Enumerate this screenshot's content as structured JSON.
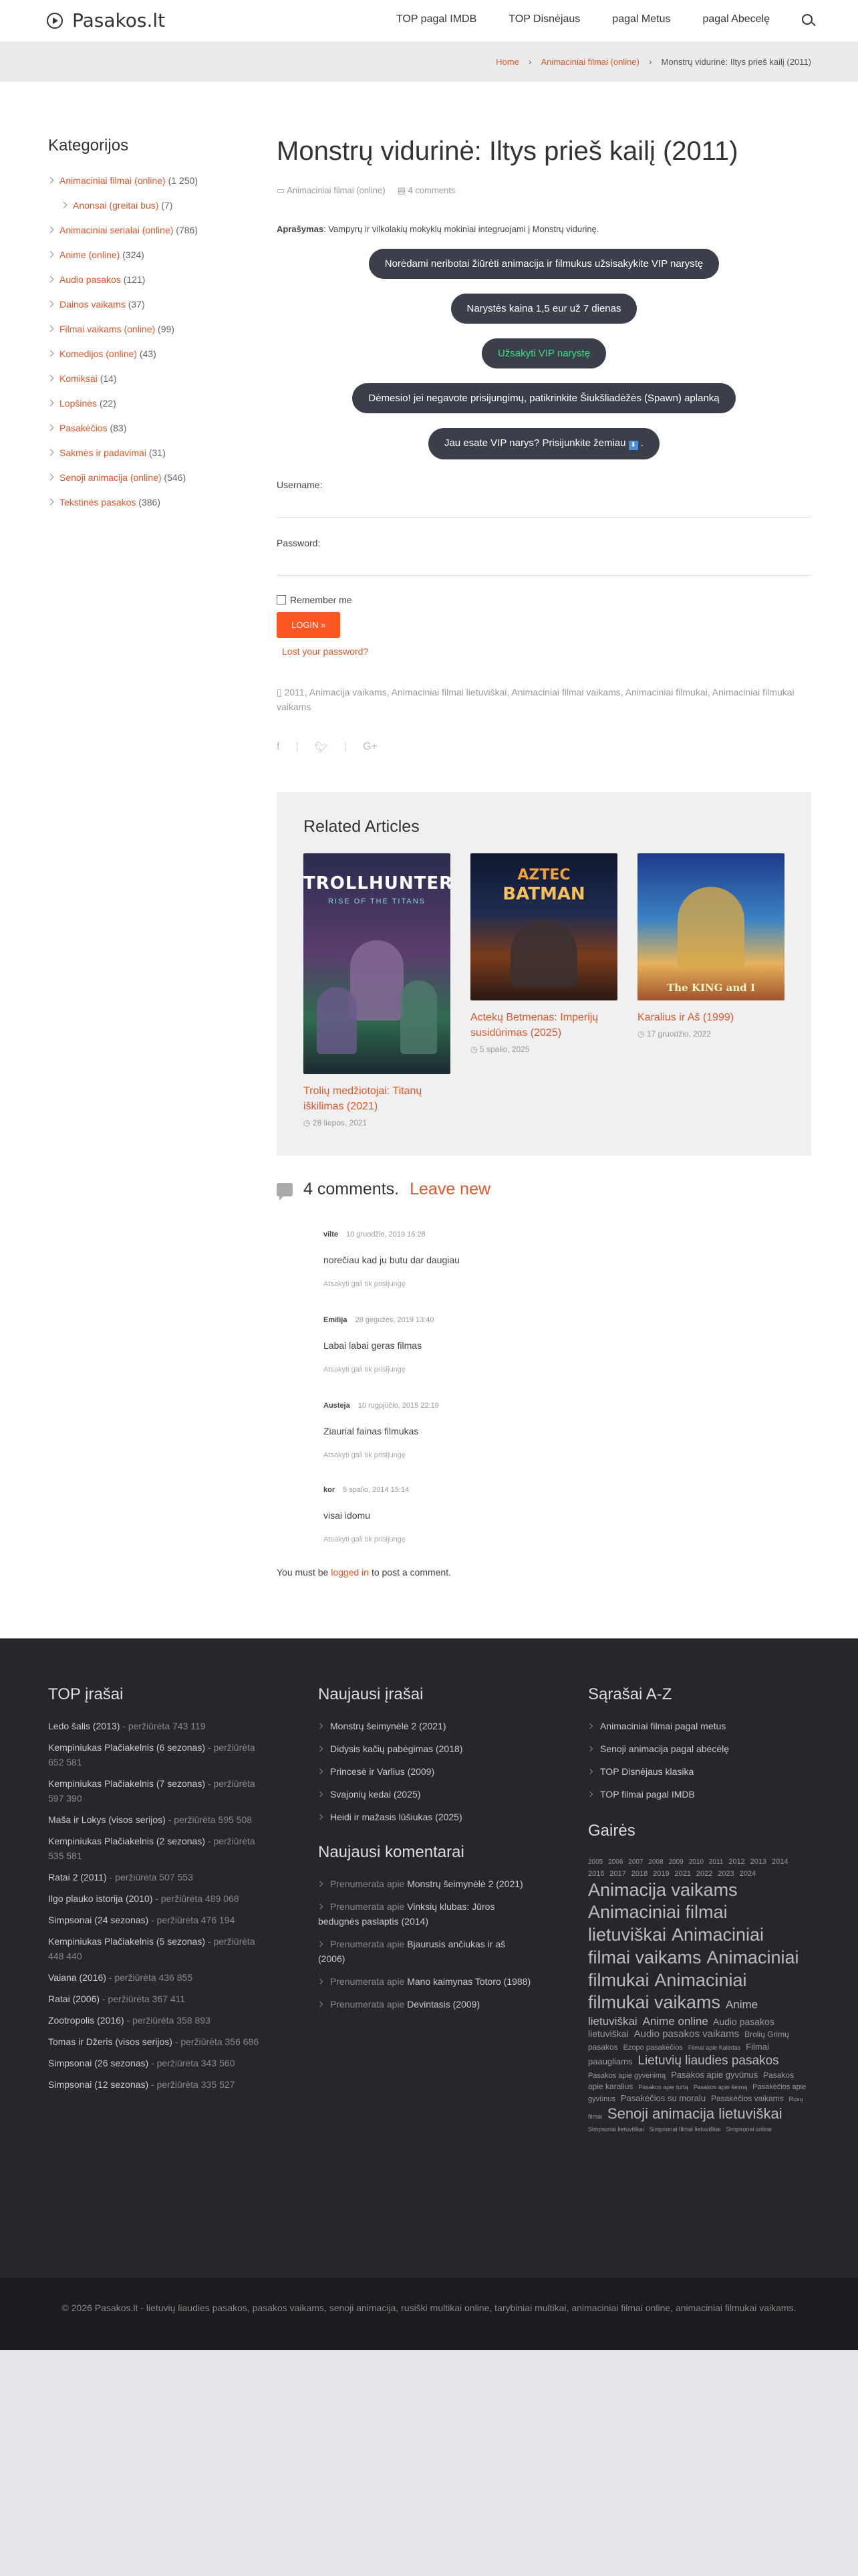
{
  "header": {
    "logo_text": "Pasakos.lt",
    "nav": [
      "TOP pagal IMDB",
      "TOP Disnėjaus",
      "pagal Metus",
      "pagal Abecelę"
    ]
  },
  "breadcrumb": {
    "home": "Home",
    "category": "Animaciniai filmai (online)",
    "current": "Monstrų vidurinė: Iltys prieš kailį (2011)"
  },
  "sidebar": {
    "title": "Kategorijos",
    "items": [
      {
        "label": "Animaciniai filmai (online)",
        "count": "(1 250)",
        "sub": false
      },
      {
        "label": "Anonsai (greitai bus)",
        "count": "(7)",
        "sub": true
      },
      {
        "label": "Animaciniai serialai (online)",
        "count": "(786)",
        "sub": false
      },
      {
        "label": "Anime (online)",
        "count": "(324)",
        "sub": false
      },
      {
        "label": "Audio pasakos",
        "count": "(121)",
        "sub": false
      },
      {
        "label": "Dainos vaikams",
        "count": "(37)",
        "sub": false
      },
      {
        "label": "Filmai vaikams (online)",
        "count": "(99)",
        "sub": false
      },
      {
        "label": "Komedijos (online)",
        "count": "(43)",
        "sub": false
      },
      {
        "label": "Komiksai",
        "count": "(14)",
        "sub": false
      },
      {
        "label": "Lopšinės",
        "count": "(22)",
        "sub": false
      },
      {
        "label": "Pasakėčios",
        "count": "(83)",
        "sub": false
      },
      {
        "label": "Sakmės ir padavimai",
        "count": "(31)",
        "sub": false
      },
      {
        "label": "Senoji animacija (online)",
        "count": "(546)",
        "sub": false
      },
      {
        "label": "Tekstinės pasakos",
        "count": "(386)",
        "sub": false
      }
    ]
  },
  "article": {
    "title": "Monstrų vidurinė: Iltys prieš kailį (2011)",
    "category": "Animaciniai filmai (online)",
    "comments_count": "4 comments",
    "desc_label": "Aprašymas",
    "desc_text": ": Vampyrų ir vilkolakių mokyklų mokiniai integruojami į Monstrų vidurinę.",
    "pills": [
      "Norėdami neribotai žiūrėti animacija ir filmukus užsisakykite VIP narystę",
      "Narystės kaina 1,5 eur už 7 dienas",
      "Užsakyti VIP narystę",
      "Dėmesio! jei negavote prisijungimų, patikrinkite Šiukšliadėžės (Spawn) aplanką",
      "Jau esate VIP narys? Prisijunkite žemiau"
    ],
    "username_label": "Username:",
    "password_label": "Password:",
    "remember_label": "Remember me",
    "login_button": "LOGIN »",
    "lost_password": "Lost your password?",
    "tags": "2011, Animacija vaikams, Animaciniai filmai lietuviškai, Animaciniai filmai vaikams, Animaciniai filmukai, Animaciniai filmukai vaikams",
    "share_icons": [
      "facebook-icon",
      "twitter-icon",
      "google-plus-icon"
    ]
  },
  "related": {
    "title": "Related Articles",
    "items": [
      {
        "title": "Trolių medžiotojai: Titanų iškilimas (2021)",
        "date": "28 liepos, 2021",
        "poster_line1": "TROLLHUNTERS",
        "poster_line2": "RISE OF THE TITANS"
      },
      {
        "title": "Actekų Betmenas: Imperijų susidūrimas (2025)",
        "date": "5 spalio, 2025",
        "poster_line1": "AZTEC",
        "poster_line2": "BATMAN"
      },
      {
        "title": "Karalius ir Aš (1999)",
        "date": "17 gruodžio, 2022",
        "poster_line1": "The KING and I",
        "poster_line2": ""
      }
    ]
  },
  "comments": {
    "heading": "4 comments.",
    "leave_new": "Leave new",
    "reply_note": "Atsakyti gali tik prisijungę",
    "list": [
      {
        "author": "vilte",
        "date": "10 gruodžio, 2019 16:28",
        "text": "norečiau kad ju butu dar daugiau"
      },
      {
        "author": "Emilija",
        "date": "28 gegužės, 2019 13:40",
        "text": "Labai labai geras filmas"
      },
      {
        "author": "Austeja",
        "date": "10 rugpjūčio, 2015 22:19",
        "text": "Ziaurial fainas filmukas"
      },
      {
        "author": "kor",
        "date": "5 spalio, 2014 15:14",
        "text": "visai idomu"
      }
    ],
    "must_before": "You must be",
    "must_link": "logged in",
    "must_after": "to post a comment."
  },
  "footer": {
    "top_title": "TOP įrašai",
    "top_items": [
      {
        "title": "Ledo šalis (2013)",
        "views": "- peržiūrėta 743 119"
      },
      {
        "title": "Kempiniukas Plačiakelnis (6 sezonas)",
        "views": "- peržiūrėta 652 581"
      },
      {
        "title": "Kempiniukas Plačiakelnis (7 sezonas)",
        "views": "- peržiūrėta 597 390"
      },
      {
        "title": "Maša ir Lokys (visos serijos)",
        "views": "- peržiūrėta 595 508"
      },
      {
        "title": "Kempiniukas Plačiakelnis (2 sezonas)",
        "views": "- peržiūrėta 535 581"
      },
      {
        "title": "Ratai 2 (2011)",
        "views": "- peržiūrėta 507 553"
      },
      {
        "title": "Ilgo plauko istorija (2010)",
        "views": "- peržiūrėta 489 068"
      },
      {
        "title": "Simpsonai (24 sezonas)",
        "views": "- peržiūrėta 476 194"
      },
      {
        "title": "Kempiniukas Plačiakelnis (5 sezonas)",
        "views": "- peržiūrėta 448 440"
      },
      {
        "title": "Vaiana (2016)",
        "views": "- peržiūrėta 436 855"
      },
      {
        "title": "Ratai (2006)",
        "views": "- peržiūrėta 367 411"
      },
      {
        "title": "Zootropolis (2016)",
        "views": "- peržiūrėta 358 893"
      },
      {
        "title": "Tomas ir Džeris (visos serijos)",
        "views": "- peržiūrėta 356 686"
      },
      {
        "title": "Simpsonai (26 sezonas)",
        "views": "- peržiūrėta 343 560"
      },
      {
        "title": "Simpsonai (12 sezonas)",
        "views": "- peržiūrėta 335 527"
      }
    ],
    "new_title": "Naujausi įrašai",
    "new_items": [
      "Monstrų šeimynėlė 2 (2021)",
      "Didysis kačių pabėgimas (2018)",
      "Princesė ir Varlius (2009)",
      "Svajonių kedai (2025)",
      "Heidi ir mažasis lūšiukas (2025)"
    ],
    "comments_title": "Naujausi komentarai",
    "comment_items": [
      {
        "who": "Prenumerata",
        "apie": "apie",
        "post": "Monstrų šeimynėlė 2 (2021)"
      },
      {
        "who": "Prenumerata",
        "apie": "apie",
        "post": "Vinksių klubas: Jūros bedugnės paslaptis (2014)"
      },
      {
        "who": "Prenumerata",
        "apie": "apie",
        "post": "Bjaurusis ančiukas ir aš (2006)"
      },
      {
        "who": "Prenumerata",
        "apie": "apie",
        "post": "Mano kaimynas Totoro (1988)"
      },
      {
        "who": "Prenumerata",
        "apie": "apie",
        "post": "Devintasis (2009)"
      }
    ],
    "az_title": "Sąrašai A-Z",
    "az_items": [
      "Animaciniai filmai pagal metus",
      "Senoji animacija pagal abėcėlę",
      "TOP Disnėjaus klasika",
      "TOP filmai pagal IMDB"
    ],
    "genres_title": "Gairės",
    "genre_tags": [
      {
        "t": "2005",
        "s": 10
      },
      {
        "t": "2006",
        "s": 10
      },
      {
        "t": "2007",
        "s": 10
      },
      {
        "t": "2008",
        "s": 10
      },
      {
        "t": "2009",
        "s": 10
      },
      {
        "t": "2010",
        "s": 10
      },
      {
        "t": "2011",
        "s": 10
      },
      {
        "t": "2012",
        "s": 11
      },
      {
        "t": "2013",
        "s": 11
      },
      {
        "t": "2014",
        "s": 11
      },
      {
        "t": "2016",
        "s": 11
      },
      {
        "t": "2017",
        "s": 11
      },
      {
        "t": "2018",
        "s": 11
      },
      {
        "t": "2019",
        "s": 11
      },
      {
        "t": "2021",
        "s": 11
      },
      {
        "t": "2022",
        "s": 11
      },
      {
        "t": "2023",
        "s": 11
      },
      {
        "t": "2024",
        "s": 11
      },
      {
        "t": "Animacija vaikams",
        "s": 27
      },
      {
        "t": "Animaciniai filmai lietuviškai",
        "s": 27
      },
      {
        "t": "Animaciniai filmai vaikams",
        "s": 27
      },
      {
        "t": "Animaciniai filmukai",
        "s": 27
      },
      {
        "t": "Animaciniai filmukai vaikams",
        "s": 27
      },
      {
        "t": "Anime lietuviškai",
        "s": 17
      },
      {
        "t": "Anime online",
        "s": 17
      },
      {
        "t": "Audio pasakos lietuviškai",
        "s": 14
      },
      {
        "t": "Audio pasakos vaikams",
        "s": 15
      },
      {
        "t": "Brolių Grimų pasakos",
        "s": 12
      },
      {
        "t": "Ezopo pasakėčios",
        "s": 11
      },
      {
        "t": "Filmai apie Kalėdas",
        "s": 9
      },
      {
        "t": "Filmai paaugliams",
        "s": 13
      },
      {
        "t": "Lietuvių liaudies pasakos",
        "s": 19
      },
      {
        "t": "Pasakos apie gyvenimą",
        "s": 11
      },
      {
        "t": "Pasakos apie gyvūnus",
        "s": 13
      },
      {
        "t": "Pasakos apie karalius",
        "s": 12
      },
      {
        "t": "Pasakos apie turtą",
        "s": 9
      },
      {
        "t": "Pasakos apie šeimą",
        "s": 9
      },
      {
        "t": "Pasakėčios apie gyvūnus",
        "s": 11
      },
      {
        "t": "Pasakėčios su moralu",
        "s": 13
      },
      {
        "t": "Pasakėčios vaikams",
        "s": 12
      },
      {
        "t": "Rusų filmai",
        "s": 9
      },
      {
        "t": "Senoji animacija lietuviškai",
        "s": 22
      },
      {
        "t": "Simpsonai lietuviškai",
        "s": 9
      },
      {
        "t": "Simpsonai filmai lietuviškai",
        "s": 9
      },
      {
        "t": "Simpsonai online",
        "s": 9
      }
    ]
  },
  "copyright": "© 2026 Pasakos.lt - lietuvių liaudies pasakos, pasakos vaikams, senoji animacija, rusiški multikai online, tarybiniai multikai, animaciniai filmai online, animaciniai filmukai vaikams.",
  "colors": {
    "accent": "#e2562b",
    "button": "#ff5722",
    "pill": "#3a3f4a",
    "vip_green": "#3ddc84",
    "footer": "#25272c"
  }
}
